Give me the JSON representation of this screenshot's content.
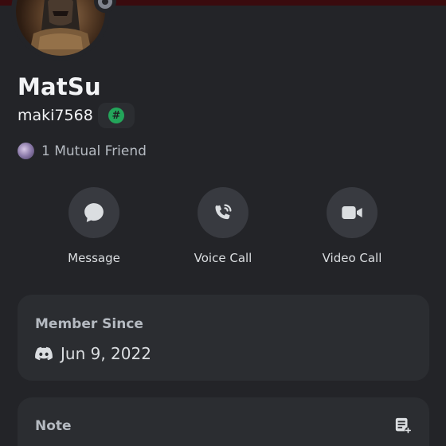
{
  "profile": {
    "display_name": "MatSu",
    "username": "maki7568",
    "tag_symbol": "#",
    "mutual_friends": "1 Mutual Friend",
    "status": "offline"
  },
  "actions": [
    {
      "label": "Message",
      "icon": "chat-bubble-icon"
    },
    {
      "label": "Voice Call",
      "icon": "phone-icon"
    },
    {
      "label": "Video Call",
      "icon": "video-camera-icon"
    }
  ],
  "member_since": {
    "title": "Member Since",
    "icon": "discord-logo-icon",
    "date": "Jun 9, 2022"
  },
  "note": {
    "title": "Note",
    "icon": "edit-note-icon"
  },
  "colors": {
    "background": "#232428",
    "card": "#2b2d31",
    "action_circle": "#383a40",
    "status_offline": "#80848e",
    "tag_green": "#23a55a"
  }
}
